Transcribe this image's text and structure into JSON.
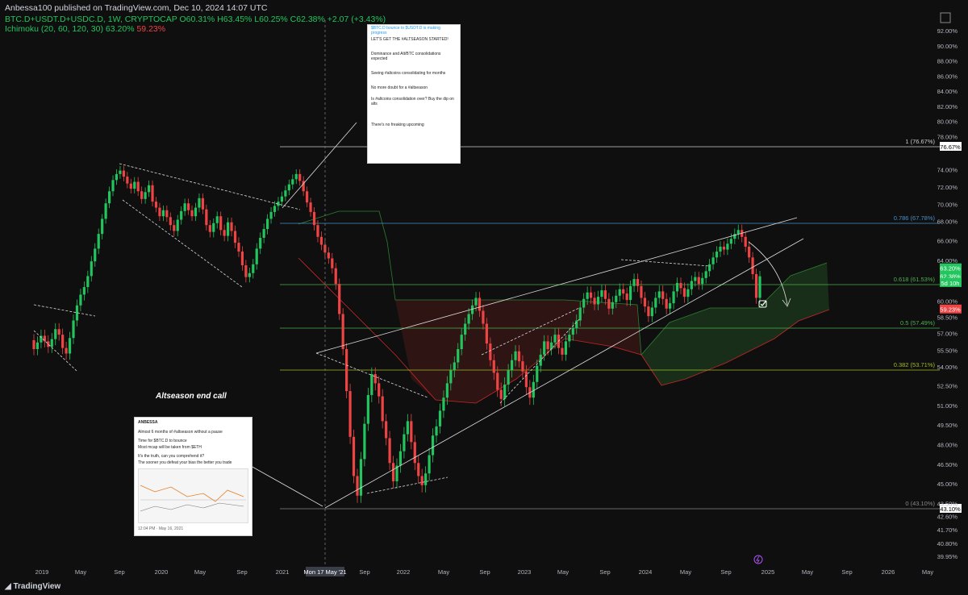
{
  "header": {
    "publisher": "Anbessa100 published on TradingView.com, Dec 10, 2024 14:07 UTC",
    "symbol": "BTC.D+USDT.D+USDC.D, 1W, CRYPTOCAP",
    "ohlc": "O60.31% H63.45% L60.25% C62.38% +2.07 (+3.43%)",
    "indicator_name": "Ichimoku (20, 60, 120, 30)",
    "indicator_v1": "63.20%",
    "indicator_v2": "59.23%"
  },
  "footer": {
    "brand": "TradingView"
  },
  "annotation": "Altseason end call",
  "colors": {
    "up": "#26a69a",
    "green": "#22c55e",
    "red": "#ef4444",
    "bg": "#0f0f0f",
    "cloud_up": "#1c3a1c",
    "cloud_down": "#4a1a1a"
  },
  "tweets": {
    "small": {
      "handle": "ANBESSA",
      "line1": "Almost 6 months of #altseason without a pause",
      "line2": "Time for $BTC.D to bounce",
      "line3": "Most mcap will be taken from $ETH",
      "line4": "It's the truth, can you comprehend it?",
      "line5": "The sooner you defeat your bias the better you trade",
      "time": "12:04 PM · May 16, 2021"
    },
    "top": {
      "lines": [
        "$BTC.D bounce to $USDT.D is making progress",
        "LET'S GET THE #ALTSEASON STARTED!",
        "Dominance and Alt/BTC consolidations expected",
        "Seeing #altcoins consolidating for months",
        "No more doubt for a #altseason",
        "Is #altcoins consolidation over? Buy the dip on alts",
        "There's no freaking upcoming"
      ]
    }
  },
  "chart_data": {
    "type": "candlestick",
    "title": "",
    "xlabel": "",
    "ylabel": "",
    "ylim": [
      39.5,
      93.0
    ],
    "x_ticks": [
      "2019",
      "May",
      "Sep",
      "2020",
      "May",
      "Sep",
      "2021",
      "Mon 17 May '21",
      "Sep",
      "2022",
      "May",
      "Sep",
      "2023",
      "May",
      "Sep",
      "2024",
      "May",
      "Sep",
      "2025",
      "May",
      "Sep",
      "2026",
      "May"
    ],
    "y_ticks": [
      "92.00%",
      "90.00%",
      "88.00%",
      "86.00%",
      "84.00%",
      "82.00%",
      "80.00%",
      "78.00%",
      "74.00%",
      "72.00%",
      "70.00%",
      "68.00%",
      "66.00%",
      "64.00%",
      "60.00%",
      "58.50%",
      "57.00%",
      "55.50%",
      "54.00%",
      "52.50%",
      "51.00%",
      "49.50%",
      "48.00%",
      "46.50%",
      "45.00%",
      "43.50%",
      "42.60%",
      "41.70%",
      "40.80%",
      "39.95%"
    ],
    "fib_levels": [
      {
        "label": "1 (76.67%)",
        "value": 76.67,
        "tag": "76.67%"
      },
      {
        "label": "0.786 (67.78%)",
        "value": 67.78
      },
      {
        "label": "0.618 (61.53%)",
        "value": 61.53
      },
      {
        "label": "0.5 (57.49%)",
        "value": 57.49
      },
      {
        "label": "0.382 (53.71%)",
        "value": 53.71
      },
      {
        "label": "0 (43.10%)",
        "value": 43.1,
        "tag": "43.10%"
      }
    ],
    "price_tags": [
      {
        "label": "63.20%",
        "value": 63.2,
        "color": "#22c55e"
      },
      {
        "label": "62.38%",
        "value": 62.38,
        "color": "#22c55e"
      },
      {
        "label": "5d 10h",
        "value": 61.7,
        "color": "#22c55e"
      },
      {
        "label": "59.23%",
        "value": 59.23,
        "color": "#ef4444"
      }
    ],
    "candles_weekly_close": [
      55.6,
      56.2,
      56.8,
      56.3,
      55.8,
      56.5,
      57.4,
      56.9,
      55.7,
      55.2,
      56.6,
      58.2,
      59.6,
      60.6,
      61.3,
      62.4,
      63.9,
      65.2,
      66.7,
      68.3,
      70.1,
      71.5,
      72.8,
      73.5,
      73.9,
      73.2,
      72.4,
      71.8,
      72.6,
      71.5,
      70.6,
      71.4,
      72.2,
      70.3,
      69.6,
      68.6,
      69.3,
      68.5,
      67.6,
      67.0,
      68.2,
      69.2,
      70.1,
      69.3,
      68.6,
      69.6,
      70.7,
      69.4,
      67.6,
      66.9,
      67.8,
      68.6,
      67.1,
      66.5,
      67.9,
      67.0,
      65.8,
      64.9,
      63.5,
      62.3,
      62.7,
      63.6,
      65.2,
      66.3,
      67.2,
      68.3,
      69.1,
      69.8,
      70.3,
      70.9,
      71.6,
      72.3,
      72.9,
      73.5,
      72.7,
      71.5,
      70.2,
      69.1,
      67.6,
      66.4,
      65.6,
      64.8,
      64.2,
      63.2,
      61.6,
      58.8,
      55.6,
      52.1,
      48.6,
      45.6,
      44.1,
      46.9,
      49.6,
      51.8,
      53.4,
      52.7,
      51.7,
      49.8,
      48.5,
      46.6,
      45.2,
      46.4,
      47.5,
      48.8,
      49.8,
      48.2,
      46.6,
      45.6,
      44.9,
      45.8,
      47.2,
      48.7,
      49.4,
      50.6,
      51.6,
      52.7,
      53.7,
      54.4,
      55.6,
      56.9,
      57.9,
      58.8,
      59.6,
      60.3,
      59.1,
      57.9,
      56.1,
      54.6,
      53.5,
      52.2,
      51.5,
      52.6,
      53.7,
      54.6,
      55.4,
      54.5,
      53.6,
      52.4,
      51.6,
      52.8,
      54.1,
      55.1,
      56.3,
      55.6,
      56.2,
      56.9,
      55.7,
      55.1,
      56.3,
      56.9,
      57.5,
      58.2,
      59.4,
      60.2,
      60.8,
      60.3,
      59.7,
      60.4,
      61.0,
      60.2,
      59.3,
      59.9,
      60.5,
      61.1,
      60.7,
      60.1,
      61.4,
      62.1,
      61.4,
      60.3,
      59.5,
      58.6,
      59.4,
      60.3,
      60.9,
      60.2,
      59.3,
      59.8,
      60.9,
      61.7,
      61.2,
      60.4,
      61.1,
      61.9,
      62.3,
      61.6,
      62.2,
      62.9,
      63.6,
      64.3,
      64.9,
      65.4,
      65.1,
      65.7,
      66.2,
      66.7,
      67.1,
      66.4,
      65.4,
      64.3,
      62.6,
      60.3,
      62.38
    ]
  }
}
